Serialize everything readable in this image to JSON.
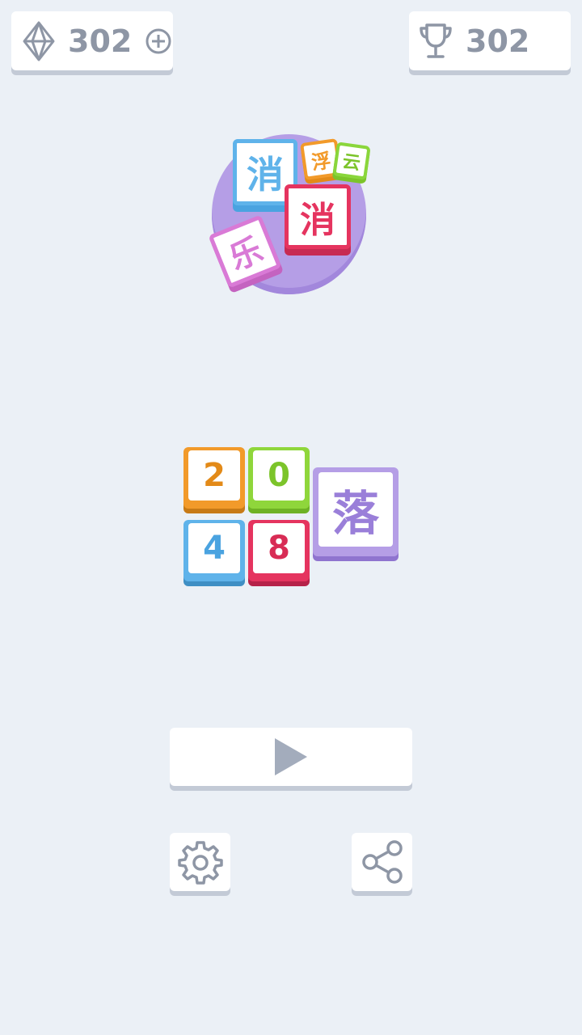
{
  "header": {
    "gems": {
      "value": "302",
      "icon": "diamond-icon",
      "add_icon": "plus-circle-icon"
    },
    "best_score": {
      "value": "302",
      "icon": "trophy-icon"
    }
  },
  "logo": {
    "tiles": [
      {
        "char": "消",
        "color": "#5fb3ea"
      },
      {
        "char": "浮",
        "color": "#f29a2a"
      },
      {
        "char": "云",
        "color": "#8ad63b"
      },
      {
        "char": "消",
        "color": "#e5345f"
      },
      {
        "char": "乐",
        "color": "#d97ad6"
      }
    ]
  },
  "title_tiles": [
    {
      "char": "2",
      "color": "#f29a2a",
      "text_color": "#e38a18"
    },
    {
      "char": "0",
      "color": "#8fd63b",
      "text_color": "#7cc42a"
    },
    {
      "char": "4",
      "color": "#5fb3ea",
      "text_color": "#4aa3e0"
    },
    {
      "char": "8",
      "color": "#e5345f",
      "text_color": "#d82c55"
    },
    {
      "char": "落",
      "color": "#b59ee6",
      "text_color": "#9a7fd9"
    }
  ],
  "buttons": {
    "play_icon": "play-icon",
    "settings_icon": "gear-icon",
    "share_icon": "share-icon"
  },
  "colors": {
    "background": "#ebf0f6",
    "icon_gray": "#8e96a5",
    "play_gray": "#a3acbc"
  }
}
